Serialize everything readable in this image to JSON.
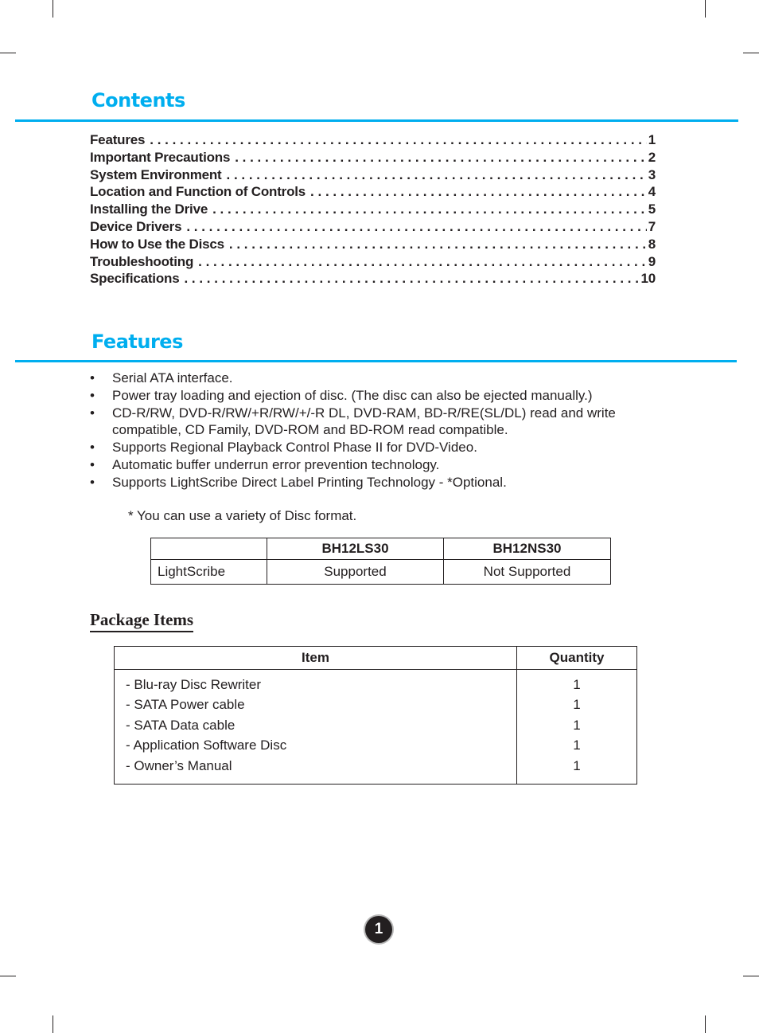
{
  "contents": {
    "title": "Contents",
    "entries": [
      {
        "label": "Features",
        "page": "1"
      },
      {
        "label": "Important Precautions",
        "page": "2"
      },
      {
        "label": "System Environment",
        "page": "3"
      },
      {
        "label": "Location and Function of Controls",
        "page": "4"
      },
      {
        "label": "Installing the Drive",
        "page": "5"
      },
      {
        "label": "Device Drivers",
        "page": "7"
      },
      {
        "label": "How to Use the Discs",
        "page": "8"
      },
      {
        "label": "Troubleshooting",
        "page": "9"
      },
      {
        "label": "Specifications",
        "page": "10"
      }
    ]
  },
  "features": {
    "title": "Features",
    "bullet": "•",
    "items": [
      "Serial ATA interface.",
      "Power tray loading and ejection of disc. (The disc can also be ejected manually.)",
      "CD-R/RW, DVD-R/RW/+R/RW/+/-R DL, DVD-RAM, BD-R/RE(SL/DL) read and write compatible, CD Family, DVD-ROM and BD-ROM read compatible.",
      "Supports Regional Playback Control Phase II for DVD-Video.",
      "Automatic buffer underrun error prevention technology.",
      "Supports LightScribe Direct Label Printing Technology - *Optional."
    ],
    "note": "*  You can use a variety of Disc format."
  },
  "lightscribe_table": {
    "headers": [
      "",
      "BH12LS30",
      "BH12NS30"
    ],
    "row": {
      "label": "LightScribe",
      "values": [
        "Supported",
        "Not Supported"
      ]
    }
  },
  "package": {
    "title": "Package Items",
    "headers": {
      "item": "Item",
      "quantity": "Quantity"
    },
    "rows": [
      {
        "item": "- Blu-ray Disc Rewriter",
        "qty": "1"
      },
      {
        "item": "- SATA Power cable",
        "qty": "1"
      },
      {
        "item": "- SATA Data cable",
        "qty": "1"
      },
      {
        "item": "- Application Software Disc",
        "qty": "1"
      },
      {
        "item": "- Owner’s Manual",
        "qty": "1"
      }
    ]
  },
  "page_number": "1"
}
